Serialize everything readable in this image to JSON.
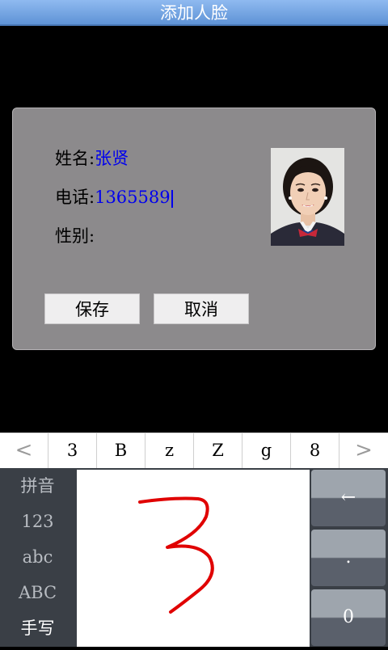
{
  "titlebar": {
    "title": "添加人脸"
  },
  "form": {
    "name_label": "姓名:",
    "name_value": "张贤",
    "phone_label": "电话:",
    "phone_value": "1365589",
    "gender_label": "性别:",
    "gender_value": ""
  },
  "buttons": {
    "save": "保存",
    "cancel": "取消"
  },
  "candidates": {
    "prev": "<",
    "items": [
      "3",
      "B",
      "z",
      "Z",
      "g",
      "8"
    ],
    "next": ">"
  },
  "ime_modes": [
    "拼音",
    "123",
    "abc",
    "ABC",
    "手写"
  ],
  "active_mode": "手写",
  "keys": {
    "backspace": "←",
    "dot": ".",
    "zero": "0"
  },
  "colors": {
    "titlebar": "#7aa9e6",
    "dialog": "#8c8a8c",
    "input_text": "#0000ee",
    "ink": "#e00000",
    "keyboard_bg": "#3a3f46"
  },
  "handwriting_char": "3"
}
